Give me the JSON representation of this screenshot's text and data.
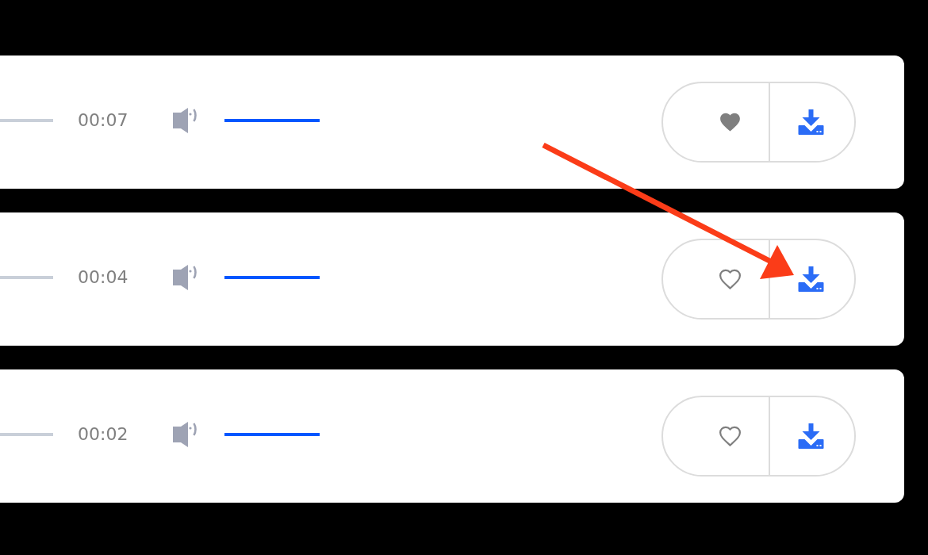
{
  "tracks": [
    {
      "elapsed": "00:07",
      "volume": {
        "level": 1
      },
      "liked": true
    },
    {
      "elapsed": "00:04",
      "volume": {
        "level": 1
      },
      "liked": false
    },
    {
      "elapsed": "00:02",
      "volume": {
        "level": 1
      },
      "liked": false
    }
  ]
}
